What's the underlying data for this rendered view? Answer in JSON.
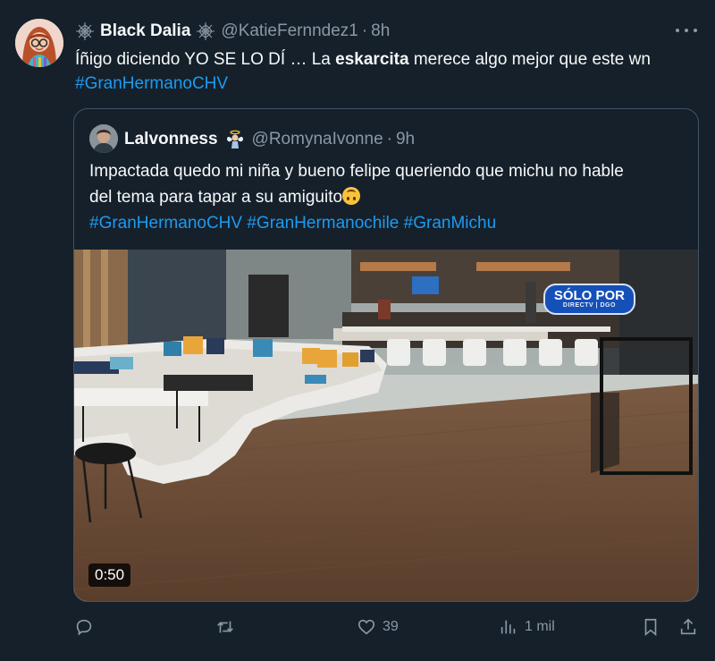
{
  "tweet": {
    "display_name": "Black Dalia",
    "handle": "@KatieFernndez1",
    "dot": "·",
    "time": "8h",
    "text_part1": "Íñigo diciendo YO SE LO DÍ … La ",
    "text_bold": "eskarcita",
    "text_part2": " merece algo mejor que este wn",
    "hashtag": "#GranHermanoCHV"
  },
  "quote": {
    "display_name": "Lalvonness",
    "handle": "@RomynaIvonne",
    "dot": "·",
    "time": "9h",
    "line1": "Impactada quedo mi niña y bueno felipe queriendo que michu no hable",
    "line2": "del tema para tapar a su amiguito",
    "hashtags": "#GranHermanoCHV #GranHermanochile #GranMichu",
    "video": {
      "duration": "0:50",
      "badge_text": "SÓLO POR",
      "badge_sub": "DIRECTV | DGO"
    }
  },
  "actions": {
    "reply_count": "",
    "retweet_count": "",
    "like_count": "39",
    "views_count": "1 mil"
  },
  "icons": [
    "spider-web-icon",
    "more-icon",
    "reply-icon",
    "retweet-icon",
    "like-icon",
    "views-icon",
    "bookmark-icon",
    "share-icon"
  ],
  "colors": {
    "background": "#15202b",
    "link": "#1d9bf0",
    "muted": "#8b98a5",
    "border": "#425364"
  }
}
